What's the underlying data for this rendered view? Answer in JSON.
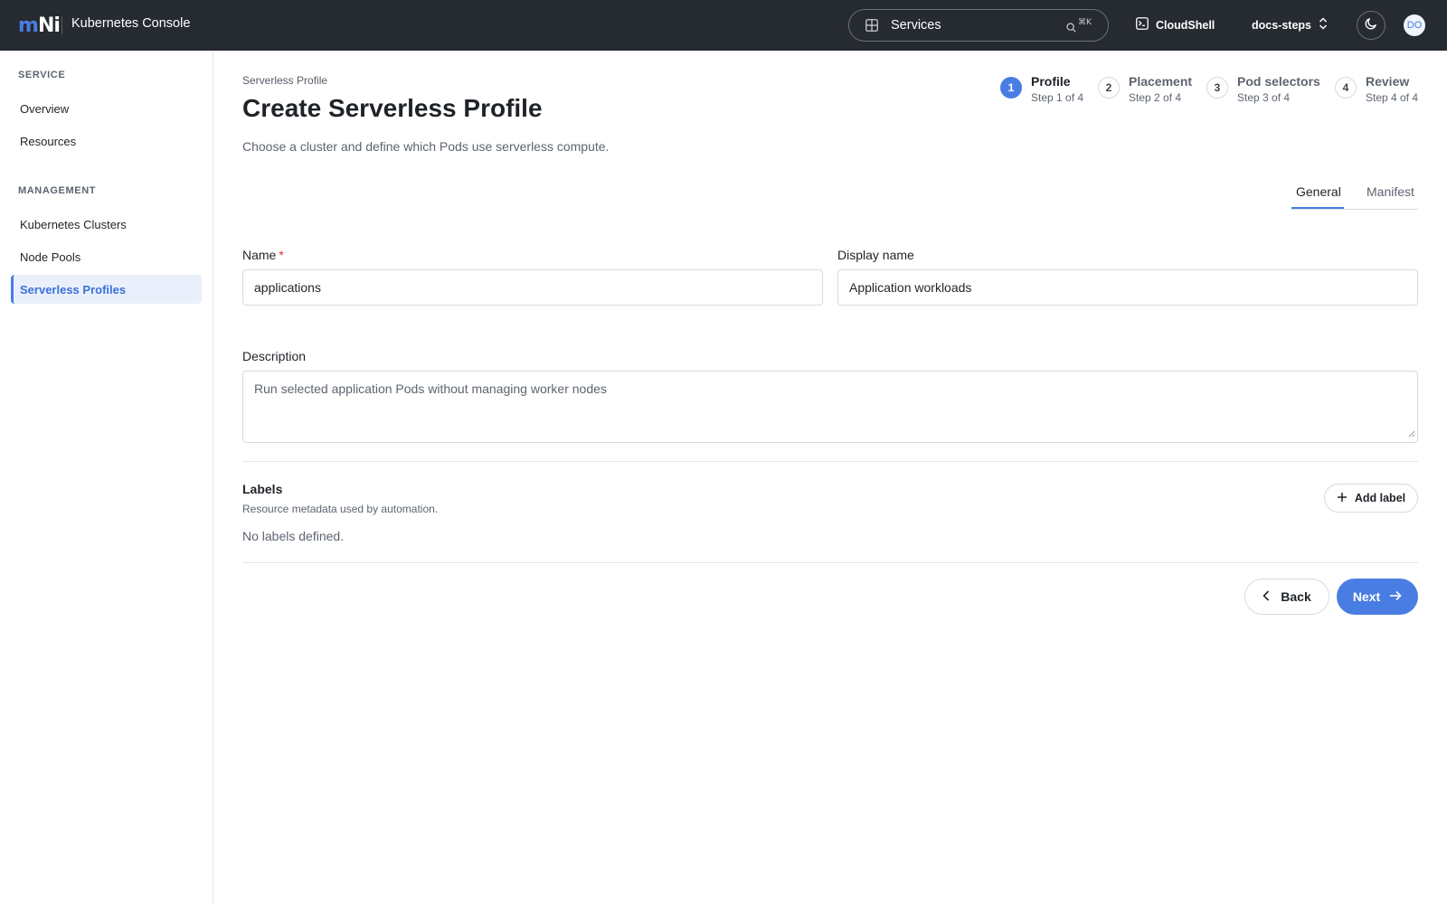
{
  "app": {
    "logo_left": "m",
    "logo_right": "Ni",
    "title": "Kubernetes Console"
  },
  "topbar": {
    "search_value": "Services",
    "search_shortcut": "⌘K",
    "cloudshell_label": "CloudShell",
    "project_label": "docs-steps",
    "avatar_initials": "DO"
  },
  "sidebar": {
    "sections": [
      {
        "heading": "SERVICE",
        "items": [
          {
            "label": "Overview"
          },
          {
            "label": "Resources"
          }
        ]
      },
      {
        "heading": "MANAGEMENT",
        "items": [
          {
            "label": "Kubernetes Clusters"
          },
          {
            "label": "Node Pools"
          },
          {
            "label": "Serverless Profiles",
            "active": true
          }
        ]
      }
    ]
  },
  "page": {
    "breadcrumb": "Serverless Profile",
    "title": "Create Serverless Profile",
    "subtitle": "Choose a cluster and define which Pods use serverless compute."
  },
  "steps": [
    {
      "number": "1",
      "label": "Profile",
      "sub": "Step 1 of 4",
      "current": true
    },
    {
      "number": "2",
      "label": "Placement",
      "sub": "Step 2 of 4"
    },
    {
      "number": "3",
      "label": "Pod selectors",
      "sub": "Step 3 of 4"
    },
    {
      "number": "4",
      "label": "Review",
      "sub": "Step 4 of 4"
    }
  ],
  "tabs": [
    {
      "label": "General",
      "active": true
    },
    {
      "label": "Manifest"
    }
  ],
  "form": {
    "name_label": "Name",
    "name_required_mark": "*",
    "name_value": "applications",
    "display_name_label": "Display name",
    "display_name_value": "Application workloads",
    "description_label": "Description",
    "description_value": "Run selected application Pods without managing worker nodes"
  },
  "labels": {
    "title": "Labels",
    "subtitle": "Resource metadata used by automation.",
    "empty_text": "No labels defined.",
    "add_button": "Add label"
  },
  "actions": {
    "back": "Back",
    "next": "Next"
  },
  "colors": {
    "topbar_bg": "#262a31",
    "accent": "#4a7de3",
    "required": "#d9362b"
  }
}
